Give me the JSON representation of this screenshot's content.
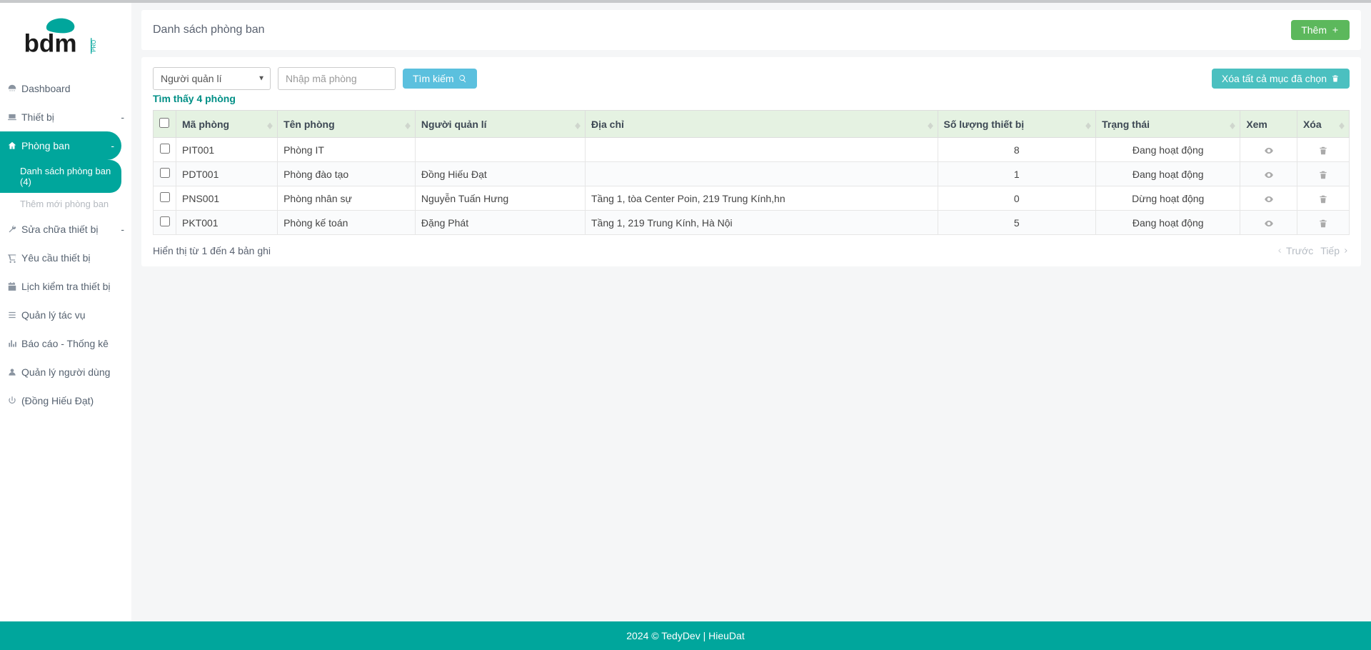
{
  "brand": {
    "name": "bdm",
    "suffix": "PRO"
  },
  "sidebar": {
    "items": [
      {
        "label": "Dashboard",
        "icon": "dashboard"
      },
      {
        "label": "Thiết bị",
        "icon": "laptop",
        "expandable": true
      },
      {
        "label": "Phòng ban",
        "icon": "home",
        "expandable": true,
        "active": true,
        "sub": [
          {
            "label": "Danh sách phòng ban (4)",
            "active": true
          },
          {
            "label": "Thêm mới phòng ban",
            "active": false
          }
        ]
      },
      {
        "label": "Sửa chữa thiết bị",
        "icon": "wrench",
        "expandable": true
      },
      {
        "label": "Yêu cầu thiết bị",
        "icon": "cart"
      },
      {
        "label": "Lịch kiểm tra thiết bị",
        "icon": "calendar"
      },
      {
        "label": "Quản lý tác vụ",
        "icon": "list"
      },
      {
        "label": "Báo cáo - Thống kê",
        "icon": "barchart"
      },
      {
        "label": "Quản lý người dùng",
        "icon": "user"
      },
      {
        "label": "(Đồng Hiếu Đạt)",
        "icon": "power"
      }
    ]
  },
  "header": {
    "title": "Danh sách phòng ban",
    "add_button": "Thêm"
  },
  "filter": {
    "select_label": "Người quản lí",
    "search_placeholder": "Nhập mã phòng",
    "search_button": "Tìm kiếm",
    "delete_selected": "Xóa tất cả mục đã chọn"
  },
  "found_text": "Tìm thấy 4 phòng",
  "table": {
    "headers": {
      "code": "Mã phòng",
      "name": "Tên phòng",
      "manager": "Người quản lí",
      "address": "Địa chỉ",
      "device_count": "Số lượng thiết bị",
      "status": "Trạng thái",
      "view": "Xem",
      "delete": "Xóa"
    },
    "rows": [
      {
        "code": "PIT001",
        "name": "Phòng IT",
        "manager": "",
        "address": "",
        "count": "8",
        "status": "Đang hoạt động"
      },
      {
        "code": "PDT001",
        "name": "Phòng đào tạo",
        "manager": "Đồng Hiếu Đạt",
        "address": "",
        "count": "1",
        "status": "Đang hoạt động"
      },
      {
        "code": "PNS001",
        "name": "Phòng nhân sự",
        "manager": "Nguyễn Tuấn Hưng",
        "address": "Tầng 1, tòa Center Poin, 219 Trung Kính,hn",
        "count": "0",
        "status": "Dừng hoạt động"
      },
      {
        "code": "PKT001",
        "name": "Phòng kế toán",
        "manager": "Đặng Phát",
        "address": "Tầng 1, 219 Trung Kính, Hà Nội",
        "count": "5",
        "status": "Đang hoạt động"
      }
    ]
  },
  "table_info": "Hiển thị từ 1 đến 4 bản ghi",
  "pager": {
    "prev": "Trước",
    "next": "Tiếp"
  },
  "footer": "2024 © TedyDev | HieuDat"
}
